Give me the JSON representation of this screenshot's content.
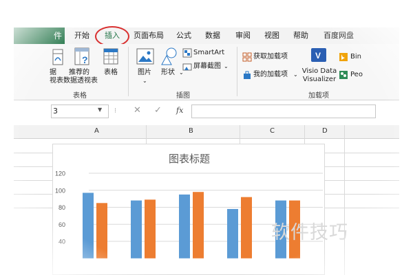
{
  "tabs": {
    "file": "件",
    "items": [
      "开始",
      "插入",
      "页面布局",
      "公式",
      "数据",
      "审阅",
      "视图",
      "帮助",
      "百度网盘"
    ]
  },
  "ribbon": {
    "partial_btn_line1": "据",
    "partial_btn_line2": "视表",
    "recommended_pivot_line1": "推荐的",
    "recommended_pivot_line2": "数据透视表",
    "table": "表格",
    "group_tables": "表格",
    "pictures": "图片",
    "shapes": "形状",
    "smartart": "SmartArt",
    "screenshot": "屏幕截图",
    "group_illustrations": "插图",
    "get_addins": "获取加载项",
    "my_addins": "我的加载项",
    "visio_line1": "Visio Data",
    "visio_line2": "Visualizer",
    "bing": "Bin",
    "people": "Peo",
    "group_addins": "加载项"
  },
  "formula_bar": {
    "name_box": "3",
    "cancel": "✕",
    "enter": "✓",
    "fx": "fx"
  },
  "columns": [
    "A",
    "B",
    "C",
    "D"
  ],
  "watermark": "软件技巧",
  "colors": {
    "excel_green": "#217346",
    "highlight_circle": "#d93030",
    "series1": "#5b9bd5",
    "series2": "#ed7d31"
  },
  "chart_data": {
    "type": "bar",
    "title": "图表标题",
    "categories": [
      "",
      "",
      "",
      "",
      ""
    ],
    "series": [
      {
        "values": [
          97,
          88,
          95,
          78,
          88
        ]
      },
      {
        "values": [
          85,
          89,
          98,
          92,
          88
        ]
      }
    ],
    "yticks": [
      40,
      60,
      80,
      100,
      120
    ],
    "ylim": [
      20,
      120
    ],
    "grid": true
  }
}
